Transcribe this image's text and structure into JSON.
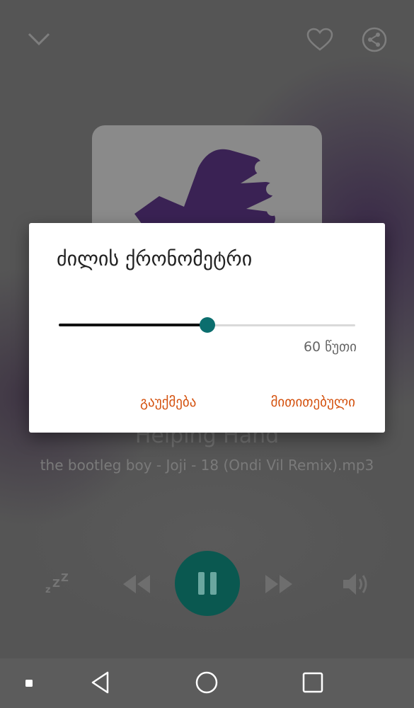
{
  "player": {
    "song_title": "Helping Hand",
    "song_artist": "the bootleg boy - Joji - 18 (Ondi Vil Remix).mp3",
    "icons": [
      "chevron-down-icon",
      "heart-icon",
      "share-icon",
      "sleep-icon",
      "rewind-icon",
      "pause-icon",
      "fast-forward-icon",
      "volume-icon"
    ]
  },
  "dialog": {
    "title": "ძილის ქრონომეტრი",
    "slider_value_label": "60 წუთი",
    "slider_fraction": 0.5,
    "cancel_label": "გაუქმება",
    "ok_label": "მითითებული"
  },
  "colors": {
    "accent": "#d4520f",
    "slider_thumb": "#0b6e6e",
    "play_button": "#0a5850"
  },
  "navbar": {
    "icons": [
      "square-dot-icon",
      "back-icon",
      "home-icon",
      "recent-apps-icon"
    ]
  }
}
